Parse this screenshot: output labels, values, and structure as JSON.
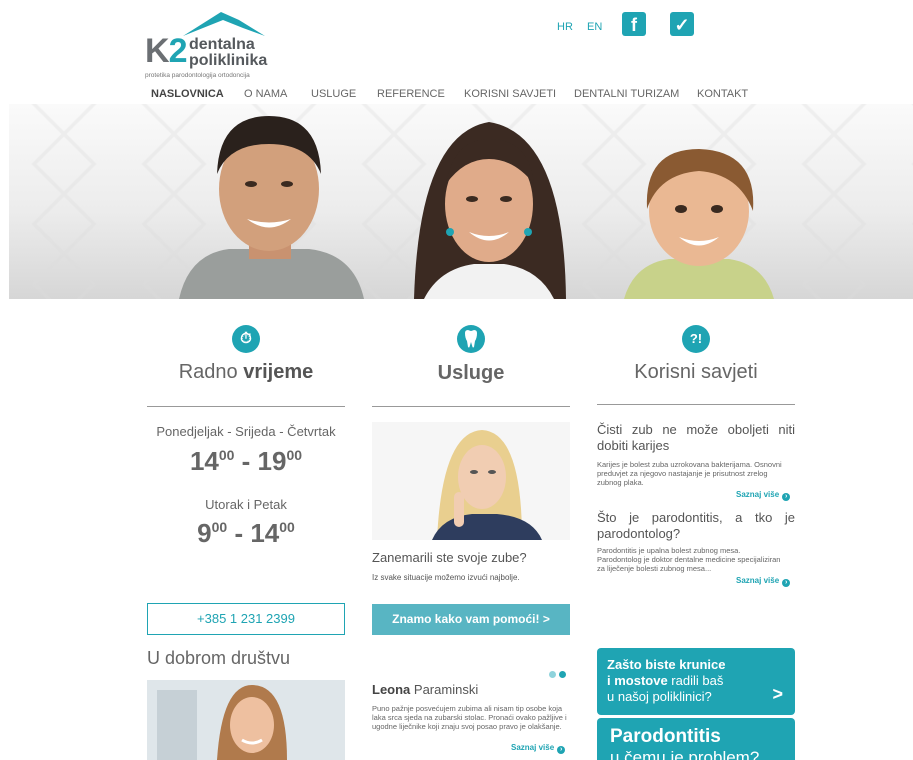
{
  "logo": {
    "k": "K",
    "two": "2",
    "line1": "dentalna",
    "line2": "poliklinika",
    "tagline": "protetika  parodontologija  ortodoncija"
  },
  "header": {
    "lang_hr": "HR",
    "lang_en": "EN",
    "facebook_glyph": "f",
    "foursquare_glyph": "✓"
  },
  "nav": [
    "NASLOVNICA",
    "O NAMA",
    "USLUGE",
    "REFERENCE",
    "KORISNI SAVJETI",
    "DENTALNI TURIZAM",
    "KONTAKT"
  ],
  "columns": {
    "hours": {
      "title_light": "Radno ",
      "title_bold": "vrijeme",
      "days1": "Ponedjeljak - Srijeda - Četvrtak",
      "time1_start": "14",
      "time1_start_sup": "00",
      "time1_sep": " - ",
      "time1_end": "19",
      "time1_end_sup": "00",
      "days2": "Utorak i Petak",
      "time2_start": "9",
      "time2_start_sup": "00",
      "time2_sep": " - ",
      "time2_end": "14",
      "time2_end_sup": "00",
      "phone": "+385 1 231 2399",
      "company_heading": "U dobrom društvu"
    },
    "services": {
      "title": "Usluge",
      "question": "Zanemarili ste svoje zube?",
      "subtext": "Iz svake situacije možemo izvući najbolje.",
      "cta": "Znamo kako vam pomoći! >",
      "testimonial_first": "Leona",
      "testimonial_last": " Paraminski",
      "testimonial_text": "Puno pažnje posvećujem zubima ali nisam tip osobe koja laka srca sjeda na zubarski stolac. Pronaći ovako pažljive i ugodne liječnike koji znaju svoj posao pravo je olakšanje.",
      "more": "Saznaj više"
    },
    "tips": {
      "title": "Korisni savjeti",
      "tip1_title": "Čisti zub ne može oboljeti niti dobiti karijes",
      "tip1_text": "Karijes je bolest zuba uzrokovana bakterijama. Osnovni preduvjet za njegovo nastajanje je prisutnost zrelog zubnog plaka.",
      "tip1_more": "Saznaj više",
      "tip2_title": "Što je parodontitis, a tko je parodontolog?",
      "tip2_text": "Parodontitis je upalna bolest zubnog mesa. Parodontolog je doktor dentalne medicine specijaliziran za liječenje bolesti zubnog mesa...",
      "tip2_more": "Saznaj više",
      "box1_l1_bold": "Zašto biste krunice",
      "box1_l2_bold": "i mostove",
      "box1_l2_rest": " radili baš",
      "box1_l3": "u našoj poliklinici?",
      "box1_arrow": ">",
      "box2_title": "Parodontitis",
      "box2_sub": "u čemu je problem?"
    }
  },
  "colors": {
    "accent": "#1fa4b3",
    "cta": "#58b5c3",
    "text": "#555555"
  }
}
